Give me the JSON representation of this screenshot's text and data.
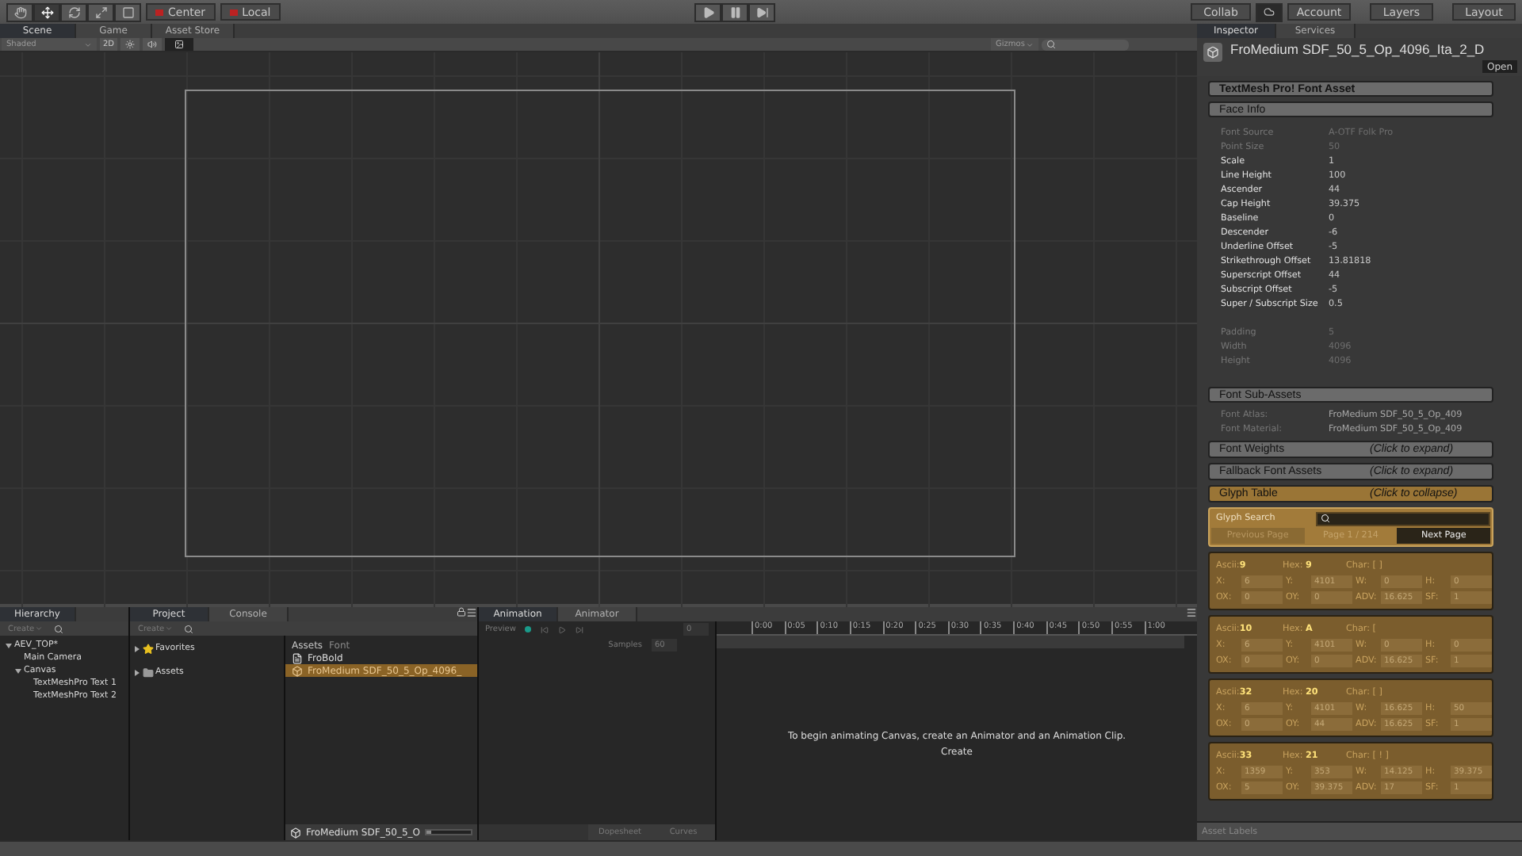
{
  "toolbar": {
    "tools": [
      {
        "selected": false
      },
      {
        "selected": true
      },
      {
        "selected": false
      },
      {
        "selected": false
      },
      {
        "selected": false
      }
    ],
    "pivot": [
      "Center",
      "Local"
    ],
    "play_controls": [
      {
        "selected": false
      },
      {
        "selected": false
      },
      {
        "selected": false
      }
    ],
    "collab": "Collab",
    "account": "Account",
    "layers": "Layers",
    "layout": "Layout"
  },
  "scene_panel": {
    "tabs": [
      {
        "label": "Scene",
        "selected": true
      },
      {
        "label": "Game",
        "selected": false
      },
      {
        "label": "Asset Store",
        "selected": false
      }
    ],
    "shading": "Shaded",
    "mode_2d": "2D",
    "gizmos": "Gizmos"
  },
  "hierarchy": {
    "tab": "Hierarchy",
    "create": "Create",
    "tree": [
      {
        "label": "AEV_TOP*",
        "expanded": true,
        "children": [
          {
            "label": "Main Camera"
          },
          {
            "label": "Canvas",
            "expanded": true,
            "children": [
              {
                "label": "TextMeshPro Text 1"
              },
              {
                "label": "TextMeshPro Text 2"
              }
            ]
          }
        ]
      }
    ]
  },
  "project": {
    "tabs": [
      {
        "label": "Project",
        "selected": true
      },
      {
        "label": "Console",
        "selected": false
      }
    ],
    "create": "Create",
    "folders": [
      {
        "kind": "favorites",
        "label": "Favorites"
      },
      {
        "kind": "folder",
        "label": "Assets"
      }
    ],
    "breadcrumb": [
      "Assets",
      "Font"
    ],
    "items": [
      {
        "kind": "font",
        "label": "FroBold",
        "selected": false
      },
      {
        "kind": "asset",
        "label": "FroMedium SDF_50_5_Op_4096_",
        "selected": true
      }
    ],
    "footer": "FroMedium SDF_50_5_O",
    "size_slider": {
      "level": 0.1
    }
  },
  "animation": {
    "tabs": [
      {
        "label": "Animation",
        "selected": true
      },
      {
        "label": "Animator",
        "selected": false
      }
    ],
    "preview": "Preview",
    "frame": "0",
    "samples_label": "Samples",
    "samples": "60",
    "ticks": [
      "0:00",
      "0:05",
      "0:10",
      "0:15",
      "0:20",
      "0:25",
      "0:30",
      "0:35",
      "0:40",
      "0:45",
      "0:50",
      "0:55",
      "1:00"
    ],
    "message": "To begin animating Canvas, create an Animator and an Animation Clip.",
    "create": "Create",
    "views": [
      {
        "label": "Dopesheet",
        "selected": false
      },
      {
        "label": "Curves",
        "selected": false
      }
    ]
  },
  "inspector": {
    "tabs": [
      {
        "label": "Inspector",
        "selected": true
      },
      {
        "label": "Services",
        "selected": false
      }
    ],
    "asset_name": "FroMedium SDF_50_5_Op_4096_Ita_2_D",
    "open": "Open",
    "header": "TextMesh Pro! Font Asset",
    "face_info": {
      "title": "Face Info",
      "rows": [
        {
          "label": "Font Source",
          "value": "A-OTF Folk Pro",
          "disabled": true
        },
        {
          "label": "Point Size",
          "value": "50",
          "disabled": true
        },
        {
          "label": "Scale",
          "value": "1",
          "disabled": false
        },
        {
          "label": "Line Height",
          "value": "100",
          "disabled": false
        },
        {
          "label": "Ascender",
          "value": "44",
          "disabled": false
        },
        {
          "label": "Cap Height",
          "value": "39.375",
          "disabled": false
        },
        {
          "label": "Baseline",
          "value": "0",
          "disabled": false
        },
        {
          "label": "Descender",
          "value": "-6",
          "disabled": false
        },
        {
          "label": "Underline Offset",
          "value": "-5",
          "disabled": false
        },
        {
          "label": "Strikethrough Offset",
          "value": "13.81818",
          "disabled": false
        },
        {
          "label": "Superscript Offset",
          "value": "44",
          "disabled": false
        },
        {
          "label": "Subscript Offset",
          "value": "-5",
          "disabled": false
        },
        {
          "label": "Super / Subscript Size",
          "value": "0.5",
          "disabled": false
        }
      ],
      "atlas_rows": [
        {
          "label": "Padding",
          "value": "5",
          "disabled": true
        },
        {
          "label": "Width",
          "value": "4096",
          "disabled": true
        },
        {
          "label": "Height",
          "value": "4096",
          "disabled": true
        }
      ]
    },
    "sub_assets": {
      "title": "Font Sub-Assets",
      "rows": [
        {
          "label": "Font Atlas:",
          "value": "FroMedium SDF_50_5_Op_409"
        },
        {
          "label": "Font Material:",
          "value": "FroMedium SDF_50_5_Op_409"
        }
      ]
    },
    "sections": [
      {
        "title": "Font Weights",
        "hint": "(Click to expand)",
        "expanded": false
      },
      {
        "title": "Fallback Font Assets",
        "hint": "(Click to expand)",
        "expanded": false
      },
      {
        "title": "Glyph Table",
        "hint": "(Click to collapse)",
        "expanded": true
      }
    ],
    "glyph_search": {
      "label": "Glyph Search",
      "prev": {
        "label": "Previous Page",
        "disabled": true
      },
      "page": "Page 1 / 214",
      "next": {
        "label": "Next Page",
        "disabled": false
      }
    },
    "glyphs": [
      {
        "ascii_label": "Ascii:",
        "ascii": "9",
        "hex_label": "Hex:",
        "hex": "9",
        "char": "Char: [  ]",
        "fields": [
          {
            "label": "X:",
            "value": "6"
          },
          {
            "label": "Y:",
            "value": "4101"
          },
          {
            "label": "W:",
            "value": "0"
          },
          {
            "label": "H:",
            "value": "0"
          },
          {
            "label": "OX:",
            "value": "0"
          },
          {
            "label": "OY:",
            "value": "0"
          },
          {
            "label": "ADV:",
            "value": "16.625"
          },
          {
            "label": "SF:",
            "value": "1"
          }
        ]
      },
      {
        "ascii_label": "Ascii:",
        "ascii": "10",
        "hex_label": "Hex:",
        "hex": "A",
        "char": "Char: [",
        "fields": [
          {
            "label": "X:",
            "value": "6"
          },
          {
            "label": "Y:",
            "value": "4101"
          },
          {
            "label": "W:",
            "value": "0"
          },
          {
            "label": "H:",
            "value": "0"
          },
          {
            "label": "OX:",
            "value": "0"
          },
          {
            "label": "OY:",
            "value": "0"
          },
          {
            "label": "ADV:",
            "value": "16.625"
          },
          {
            "label": "SF:",
            "value": "1"
          }
        ]
      },
      {
        "ascii_label": "Ascii:",
        "ascii": "32",
        "hex_label": "Hex:",
        "hex": "20",
        "char": "Char: [  ]",
        "fields": [
          {
            "label": "X:",
            "value": "6"
          },
          {
            "label": "Y:",
            "value": "4101"
          },
          {
            "label": "W:",
            "value": "16.625"
          },
          {
            "label": "H:",
            "value": "50"
          },
          {
            "label": "OX:",
            "value": "0"
          },
          {
            "label": "OY:",
            "value": "44"
          },
          {
            "label": "ADV:",
            "value": "16.625"
          },
          {
            "label": "SF:",
            "value": "1"
          }
        ]
      },
      {
        "ascii_label": "Ascii:",
        "ascii": "33",
        "hex_label": "Hex:",
        "hex": "21",
        "char": "Char: [ ! ]",
        "fields": [
          {
            "label": "X:",
            "value": "1359"
          },
          {
            "label": "Y:",
            "value": "353"
          },
          {
            "label": "W:",
            "value": "14.125"
          },
          {
            "label": "H:",
            "value": "39.375"
          },
          {
            "label": "OX:",
            "value": "5"
          },
          {
            "label": "OY:",
            "value": "39.375"
          },
          {
            "label": "ADV:",
            "value": "17"
          },
          {
            "label": "SF:",
            "value": "1"
          }
        ]
      }
    ],
    "asset_labels": "Asset Labels"
  }
}
